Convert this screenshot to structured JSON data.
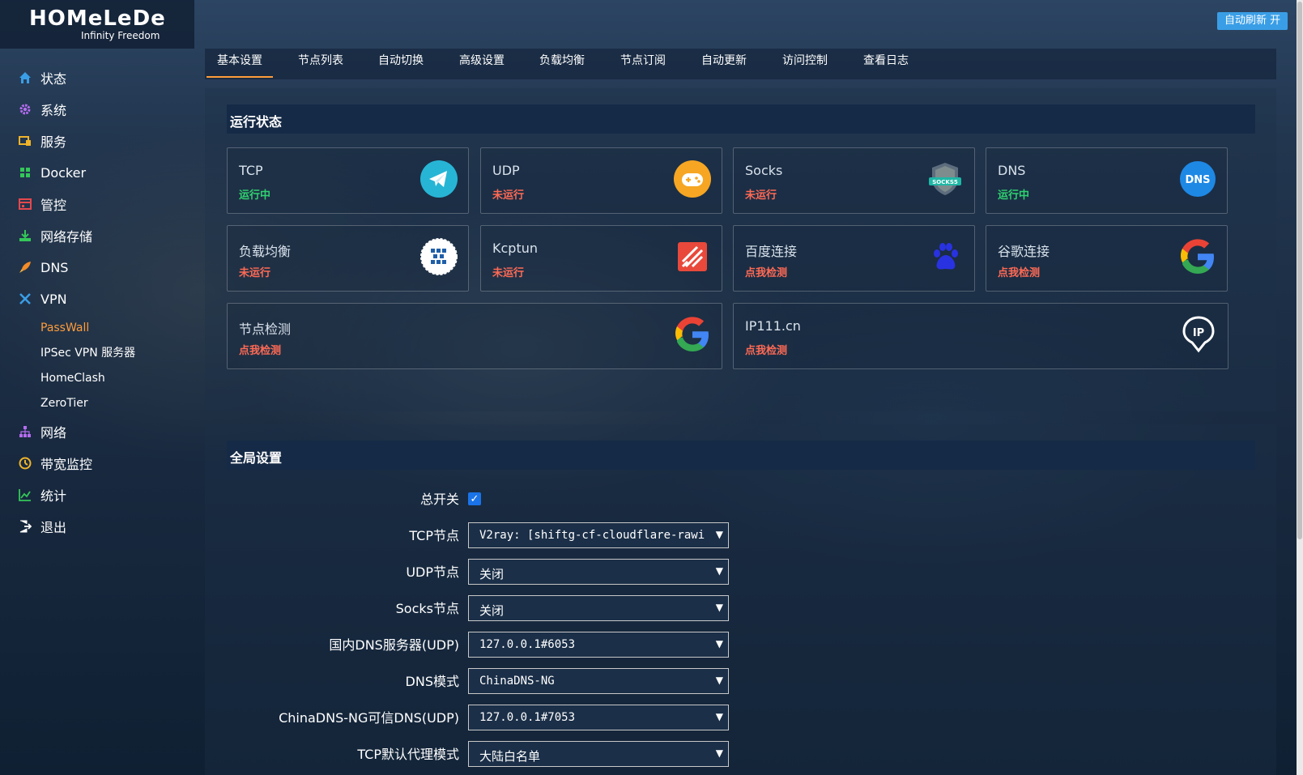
{
  "header": {
    "logo_main": "HOMeLeDe",
    "logo_sub": "Infinity Freedom",
    "refresh_button": "自动刷新 开"
  },
  "sidebar": {
    "items": [
      {
        "label": "状态",
        "icon": "home-icon"
      },
      {
        "label": "系统",
        "icon": "gear-icon"
      },
      {
        "label": "服务",
        "icon": "services-icon"
      },
      {
        "label": "Docker",
        "icon": "docker-icon"
      },
      {
        "label": "管控",
        "icon": "control-icon"
      },
      {
        "label": "网络存储",
        "icon": "storage-icon"
      },
      {
        "label": "DNS",
        "icon": "rocket-icon"
      },
      {
        "label": "VPN",
        "icon": "vpn-icon"
      },
      {
        "label": "网络",
        "icon": "network-icon"
      },
      {
        "label": "带宽监控",
        "icon": "gauge-icon"
      },
      {
        "label": "统计",
        "icon": "chart-icon"
      },
      {
        "label": "退出",
        "icon": "logout-icon"
      }
    ],
    "vpn_sub": [
      "PassWall",
      "IPSec VPN 服务器",
      "HomeClash",
      "ZeroTier"
    ]
  },
  "tabs": [
    "基本设置",
    "节点列表",
    "自动切换",
    "高级设置",
    "负载均衡",
    "节点订阅",
    "自动更新",
    "访问控制",
    "查看日志"
  ],
  "status_section": {
    "title": "运行状态",
    "cards": [
      {
        "title": "TCP",
        "status": "运行中",
        "icon": "telegram-icon"
      },
      {
        "title": "UDP",
        "status": "未运行",
        "icon": "gamepad-icon"
      },
      {
        "title": "Socks",
        "status": "未运行",
        "icon": "socks5-shield-icon"
      },
      {
        "title": "DNS",
        "status": "运行中",
        "icon": "dns-icon",
        "icon_text": "DNS"
      },
      {
        "title": "负载均衡",
        "status": "未运行",
        "icon": "load-balance-icon"
      },
      {
        "title": "Kcptun",
        "status": "未运行",
        "icon": "kcptun-icon"
      },
      {
        "title": "百度连接",
        "status": "点我检测",
        "icon": "baidu-paw-icon"
      },
      {
        "title": "谷歌连接",
        "status": "点我检测",
        "icon": "google-icon"
      },
      {
        "title": "节点检测",
        "status": "点我检测",
        "icon": "google-icon"
      },
      {
        "title": "IP111.cn",
        "status": "点我检测",
        "icon": "ip-pin-icon",
        "icon_text": "IP"
      }
    ]
  },
  "global_section": {
    "title": "全局设置",
    "master_switch_label": "总开关",
    "fields": [
      {
        "label": "TCP节点",
        "value": "V2ray: [shiftg-cf-cloudflare-rawi"
      },
      {
        "label": "UDP节点",
        "value": "关闭"
      },
      {
        "label": "Socks节点",
        "value": "关闭"
      },
      {
        "label": "国内DNS服务器(UDP)",
        "value": "127.0.0.1#6053"
      },
      {
        "label": "DNS模式",
        "value": "ChinaDNS-NG"
      },
      {
        "label": "ChinaDNS-NG可信DNS(UDP)",
        "value": "127.0.0.1#7053"
      },
      {
        "label": "TCP默认代理模式",
        "value": "大陆白名单"
      }
    ]
  },
  "colors": {
    "accent": "#ff9c3a",
    "running": "#2fd270",
    "stopped": "#ff6a55",
    "refresh_button": "#3a9ee6"
  }
}
